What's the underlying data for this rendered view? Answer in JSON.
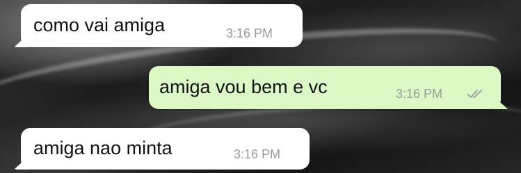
{
  "messages": [
    {
      "direction": "incoming",
      "text": "como vai amiga",
      "time": "3:16 PM"
    },
    {
      "direction": "outgoing",
      "text": "amiga vou bem e vc",
      "time": "3:16 PM",
      "status_icon": "double-check-icon"
    },
    {
      "direction": "incoming",
      "text": "amiga nao minta",
      "time": "3:16 PM"
    }
  ],
  "colors": {
    "incoming_bubble": "#ffffff",
    "outgoing_bubble": "#dcf8c6",
    "timestamp": "#9a9a9a"
  }
}
